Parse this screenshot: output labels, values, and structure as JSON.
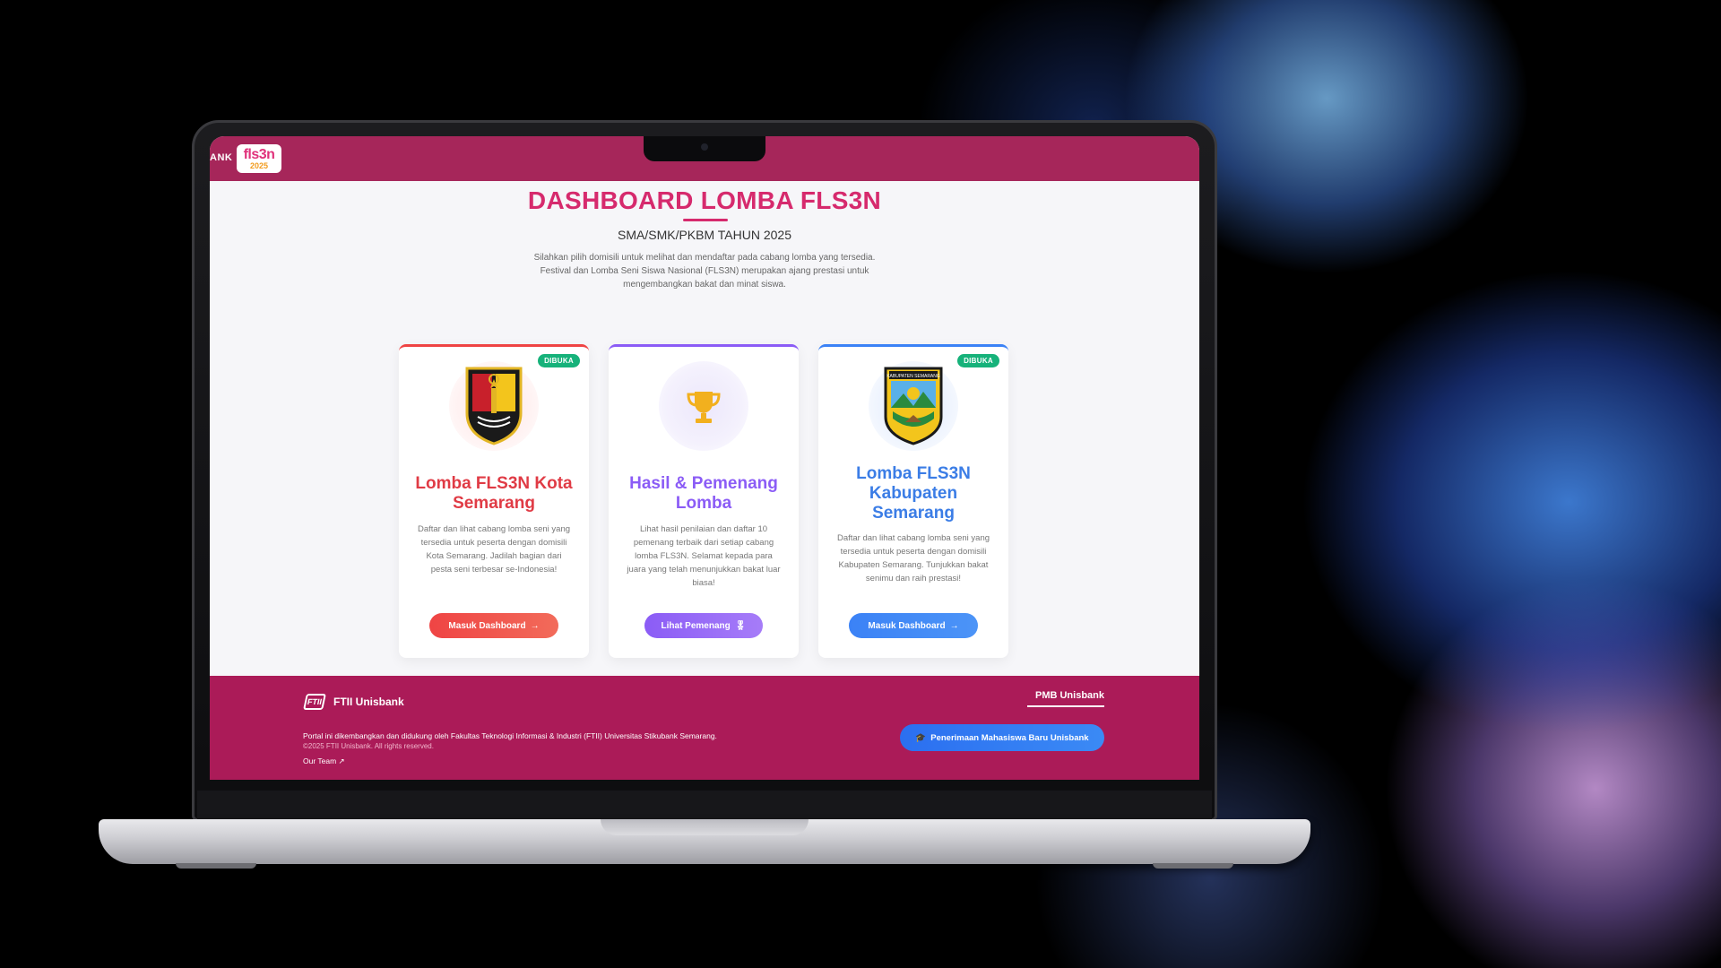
{
  "topbar": {
    "brand_fragment": "ANK",
    "logo_text_top": "fls3n",
    "logo_text_bottom": "2025"
  },
  "header": {
    "title": "DASHBOARD LOMBA FLS3N",
    "subtitle": "SMA/SMK/PKBM TAHUN 2025",
    "description": "Silahkan pilih domisili untuk melihat dan mendaftar pada cabang lomba yang tersedia. Festival dan Lomba Seni Siswa Nasional (FLS3N) merupakan ajang prestasi untuk mengembangkan bakat dan minat siswa."
  },
  "cards": [
    {
      "badge": "DIBUKA",
      "title": "Lomba FLS3N Kota Semarang",
      "description": "Daftar dan lihat cabang lomba seni yang tersedia untuk peserta dengan domisili Kota Semarang. Jadilah bagian dari pesta seni terbesar se-Indonesia!",
      "button": "Masuk Dashboard",
      "button_icon": "→",
      "accent": "#ef4444"
    },
    {
      "title": "Hasil & Pemenang Lomba",
      "description": "Lihat hasil penilaian dan daftar 10 pemenang terbaik dari setiap cabang lomba FLS3N. Selamat kepada para juara yang telah menunjukkan bakat luar biasa!",
      "button": "Lihat Pemenang",
      "button_icon": "🎖",
      "accent": "#8b5cf6"
    },
    {
      "badge": "DIBUKA",
      "title": "Lomba FLS3N Kabupaten Semarang",
      "description": "Daftar dan lihat cabang lomba seni yang tersedia untuk peserta dengan domisili Kabupaten Semarang. Tunjukkan bakat senimu dan raih prestasi!",
      "button": "Masuk Dashboard",
      "button_icon": "→",
      "accent": "#3b82f6",
      "emblem_banner": "KABUPATEN SEMARANG"
    }
  ],
  "footer": {
    "logo_text": "FTII",
    "org_name": "FTII Unisbank",
    "text": "Portal ini dikembangkan dan didukung oleh Fakultas Teknologi Informasi & Industri (FTII) Universitas Stikubank Semarang.",
    "copyright": "©2025 FTII Unisbank. All rights reserved.",
    "team_link": "Our Team",
    "team_icon": "↗",
    "pmb_title": "PMB Unisbank",
    "pmb_button": "Penerimaan Mahasiswa Baru Unisbank",
    "pmb_icon": "🎓"
  },
  "colors": {
    "topbar": "#a6265a",
    "footer": "#ab1b58",
    "title": "#d62a6d",
    "badge": "#16b27a"
  }
}
